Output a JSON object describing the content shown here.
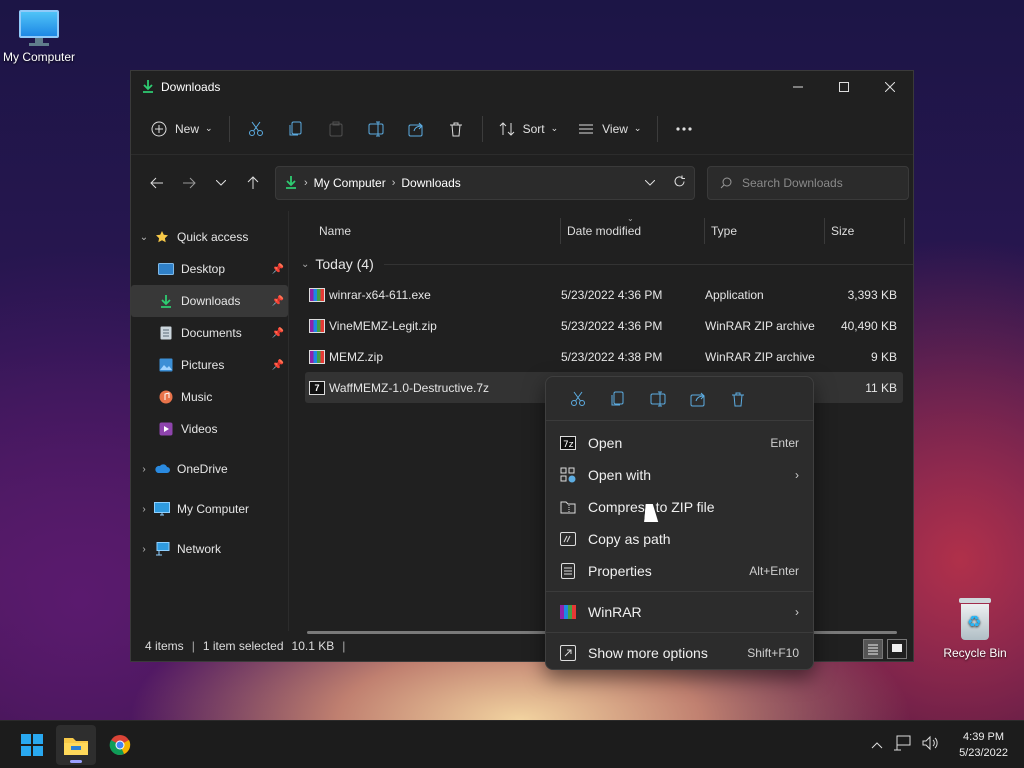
{
  "desktop": {
    "icons": [
      {
        "label": "My Computer"
      },
      {
        "label": "Recycle Bin"
      }
    ]
  },
  "window": {
    "title": "Downloads",
    "toolbar": {
      "new_label": "New",
      "sort_label": "Sort",
      "view_label": "View"
    },
    "address": {
      "crumbs": [
        "My Computer",
        "Downloads"
      ]
    },
    "search": {
      "placeholder": "Search Downloads"
    },
    "sidebar": {
      "items": [
        {
          "label": "Quick access"
        },
        {
          "label": "Desktop"
        },
        {
          "label": "Downloads"
        },
        {
          "label": "Documents"
        },
        {
          "label": "Pictures"
        },
        {
          "label": "Music"
        },
        {
          "label": "Videos"
        },
        {
          "label": "OneDrive"
        },
        {
          "label": "My Computer"
        },
        {
          "label": "Network"
        }
      ]
    },
    "columns": [
      "Name",
      "Date modified",
      "Type",
      "Size"
    ],
    "group": "Today (4)",
    "files": [
      {
        "name": "winrar-x64-611.exe",
        "date": "5/23/2022 4:36 PM",
        "type": "Application",
        "size": "3,393 KB"
      },
      {
        "name": "VineMEMZ-Legit.zip",
        "date": "5/23/2022 4:36 PM",
        "type": "WinRAR ZIP archive",
        "size": "40,490 KB"
      },
      {
        "name": "MEMZ.zip",
        "date": "5/23/2022 4:38 PM",
        "type": "WinRAR ZIP archive",
        "size": "9 KB"
      },
      {
        "name": "WaffMEMZ-1.0-Destructive.7z",
        "date": "",
        "type": "",
        "size": "11 KB"
      }
    ],
    "status": {
      "count": "4 items",
      "selected": "1 item selected",
      "size": "10.1 KB"
    }
  },
  "context_menu": {
    "items": [
      {
        "label": "Open",
        "shortcut": "Enter"
      },
      {
        "label": "Open with",
        "shortcut": ""
      },
      {
        "label": "Compress to ZIP file",
        "shortcut": ""
      },
      {
        "label": "Copy as path",
        "shortcut": ""
      },
      {
        "label": "Properties",
        "shortcut": "Alt+Enter"
      },
      {
        "label": "WinRAR",
        "shortcut": ""
      },
      {
        "label": "Show more options",
        "shortcut": "Shift+F10"
      }
    ]
  },
  "taskbar": {
    "time": "4:39 PM",
    "date": "5/23/2022"
  },
  "colors": {
    "accent_green": "#2ecc71",
    "window_bg": "#202020",
    "folder_yellow": "#f7c948",
    "taskbar_bg": "#1c1c1c"
  }
}
